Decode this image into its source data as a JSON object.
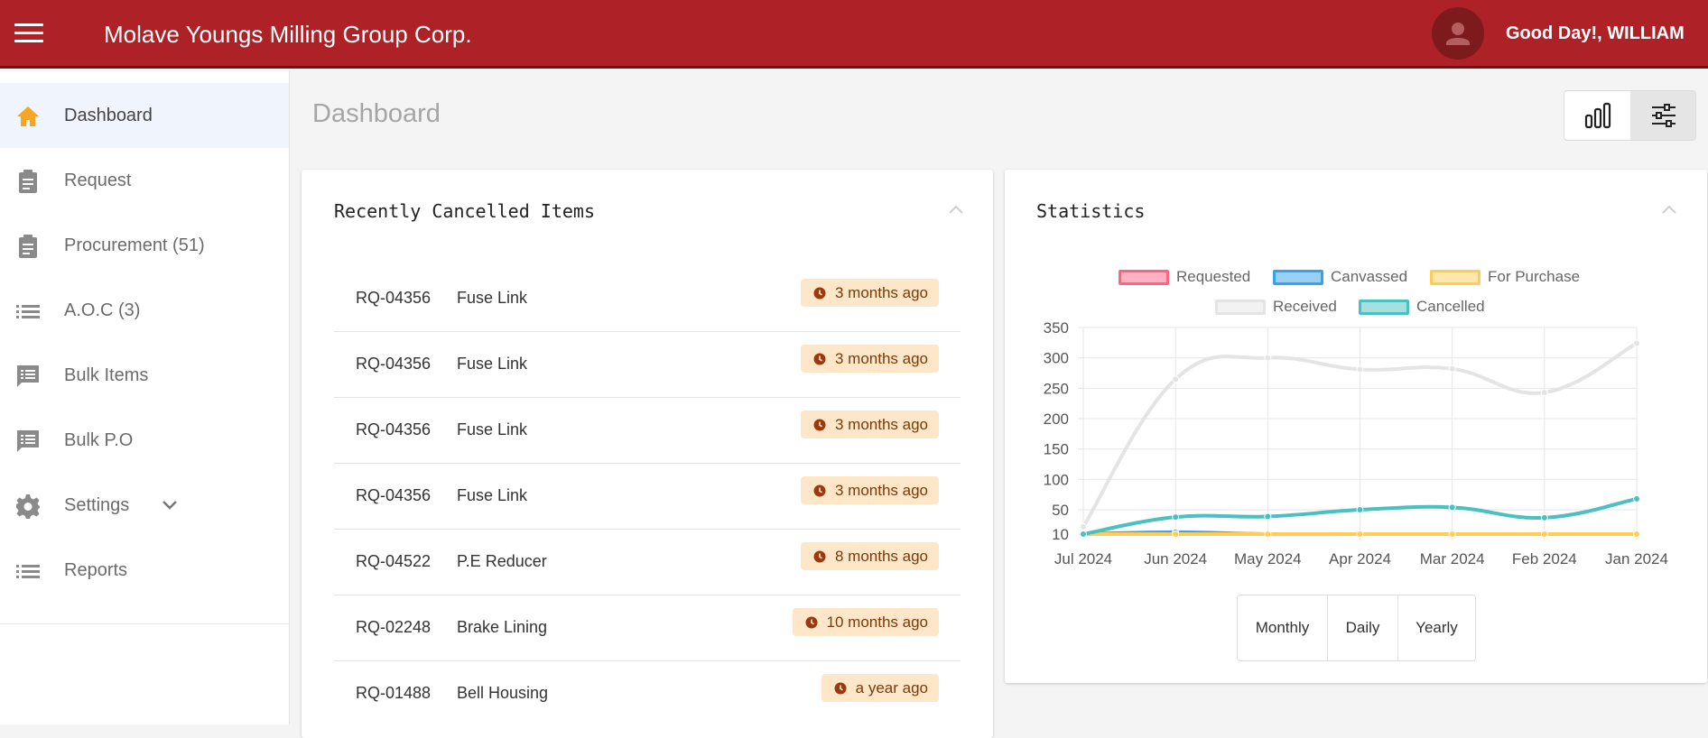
{
  "header": {
    "brand": "Molave Youngs Milling Group Corp.",
    "greeting": "Good Day!, WILLIAM",
    "menu_icon": "hamburger-icon",
    "avatar_icon": "user-avatar-icon",
    "bg_color": "#ad2127"
  },
  "sidebar": {
    "items": [
      {
        "label": "Dashboard",
        "icon": "home-icon",
        "active": true
      },
      {
        "label": "Request",
        "icon": "clipboard-icon"
      },
      {
        "label": "Procurement (51)",
        "icon": "clipboard-icon"
      },
      {
        "label": "A.O.C (3)",
        "icon": "list-icon"
      },
      {
        "label": "Bulk Items",
        "icon": "message-list-icon"
      },
      {
        "label": "Bulk P.O",
        "icon": "message-list-icon"
      },
      {
        "label": "Settings",
        "icon": "gear-icon"
      },
      {
        "label": "Reports",
        "icon": "list-icon"
      }
    ]
  },
  "page": {
    "title": "Dashboard",
    "view_toggle_icons": [
      "bar-chart-icon",
      "sliders-icon"
    ]
  },
  "cancelled": {
    "title": "Recently Cancelled Items",
    "rows": [
      {
        "rq": "RQ-04356",
        "item": "Fuse Link",
        "time": "3 months ago"
      },
      {
        "rq": "RQ-04356",
        "item": "Fuse Link",
        "time": "3 months ago"
      },
      {
        "rq": "RQ-04356",
        "item": "Fuse Link",
        "time": "3 months ago"
      },
      {
        "rq": "RQ-04356",
        "item": "Fuse Link",
        "time": "3 months ago"
      },
      {
        "rq": "RQ-04522",
        "item": "P.E Reducer",
        "time": "8 months ago"
      },
      {
        "rq": "RQ-02248",
        "item": "Brake Lining",
        "time": "10 months ago"
      },
      {
        "rq": "RQ-01488",
        "item": "Bell Housing",
        "time": "a year ago"
      }
    ]
  },
  "stats": {
    "title": "Statistics",
    "range_buttons": [
      "Monthly",
      "Daily",
      "Yearly"
    ]
  },
  "chart_data": {
    "type": "line",
    "title": "",
    "categories": [
      "Jul 2024",
      "Jun 2024",
      "May 2024",
      "Apr 2024",
      "Mar 2024",
      "Feb 2024",
      "Jan 2024"
    ],
    "y_ticks": [
      10,
      50,
      100,
      150,
      200,
      250,
      300,
      350
    ],
    "ylim": [
      10,
      350
    ],
    "grid": true,
    "legend_position": "top",
    "series": [
      {
        "name": "Requested",
        "color": "#ff6384",
        "fill": "#ffb1c1",
        "values": [
          0,
          0,
          0,
          0,
          0,
          0,
          0
        ]
      },
      {
        "name": "Canvassed",
        "color": "#36a2eb",
        "fill": "#9ad0f5",
        "values": [
          10,
          13,
          10,
          10,
          5,
          5,
          5
        ]
      },
      {
        "name": "For Purchase",
        "color": "#ffcd56",
        "fill": "#ffe6aa",
        "values": [
          0,
          0,
          0,
          0,
          0,
          0,
          0
        ]
      },
      {
        "name": "Received",
        "color": "#e4e4e4",
        "fill": "#f2f2f2",
        "values": [
          22,
          265,
          300,
          281,
          282,
          243,
          324
        ]
      },
      {
        "name": "Cancelled",
        "color": "#4bc0c0",
        "fill": "#a5dfdf",
        "values": [
          10,
          38,
          39,
          50,
          54,
          37,
          68
        ]
      }
    ]
  }
}
